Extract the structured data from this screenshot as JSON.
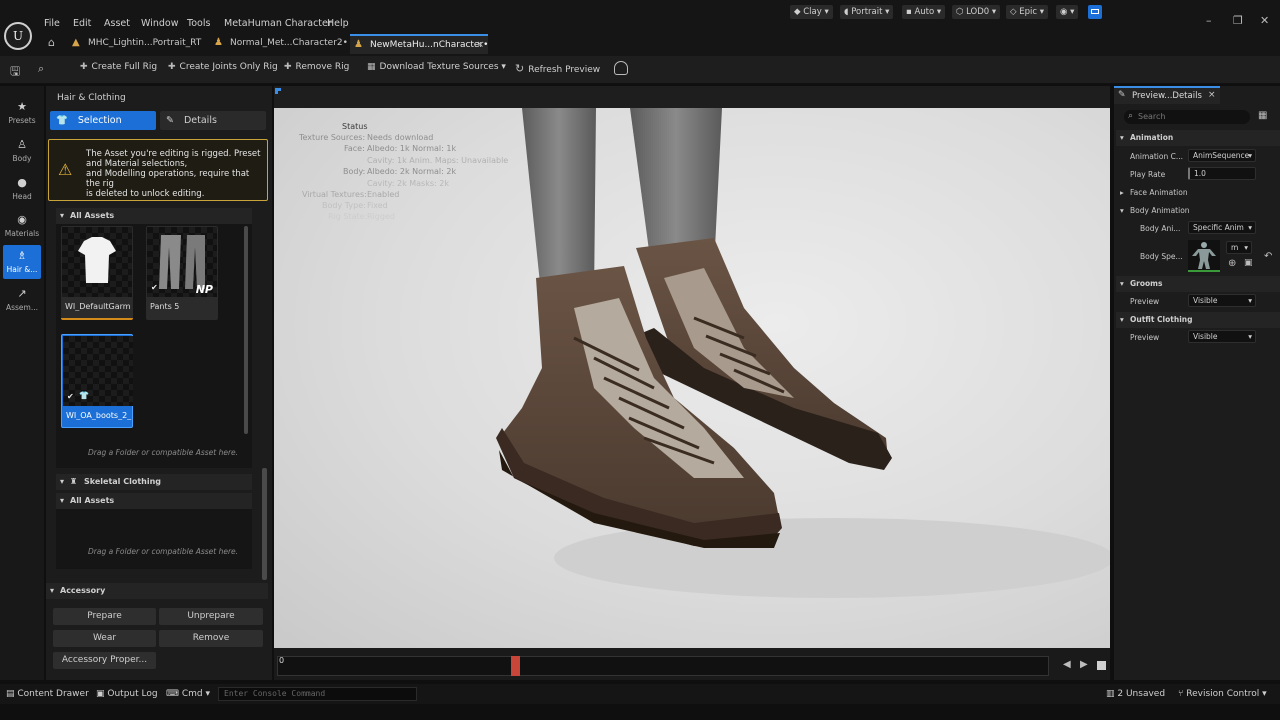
{
  "menu": [
    "File",
    "Edit",
    "Asset",
    "Window",
    "Tools",
    "MetaHuman Character",
    "Help"
  ],
  "tabs": [
    {
      "label": "MHC_Lightin...Portrait_RT",
      "active": false
    },
    {
      "label": "Normal_Met...Character2•",
      "active": false
    },
    {
      "label": "NewMetaHu...nCharacter•",
      "active": true
    }
  ],
  "toolbar": {
    "create_full_rig": "Create Full Rig",
    "create_joints_only_rig": "Create Joints Only Rig",
    "remove_rig": "Remove Rig",
    "download_texture_sources": "Download Texture Sources",
    "refresh_preview": "Refresh Preview"
  },
  "rail": [
    "Presets",
    "Body",
    "Head",
    "Materials",
    "Hair &...",
    "Assem..."
  ],
  "left_panel": {
    "title": "Hair & Clothing",
    "selection": "Selection",
    "details": "Details",
    "warning": "The Asset you're editing is rigged. Preset\nand Material selections,\nand Modelling operations, require that the rig\nis deleted to unlock editing.",
    "all_assets": "All Assets",
    "assets": [
      {
        "label": "WI_DefaultGarment"
      },
      {
        "label": "Pants 5",
        "badge": "NP"
      },
      {
        "label": "WI_OA_boots_2_..."
      }
    ],
    "drop_hint": "Drag a Folder or compatible Asset here.",
    "skeletal_clothing": "Skeletal Clothing",
    "all_assets_2": "All Assets",
    "drop_hint_2": "Drag a Folder or compatible Asset here.",
    "accessory": "Accessory",
    "buttons": {
      "prepare": "Prepare",
      "unprepare": "Unprepare",
      "wear": "Wear",
      "remove": "Remove",
      "accessory_properties": "Accessory Proper..."
    }
  },
  "viewport": {
    "clay": "Clay",
    "portrait": "Portrait",
    "auto": "Auto",
    "lod": "LOD0",
    "epic": "Epic",
    "status_title": "Status",
    "status_lines": [
      {
        "k": "Texture Sources:",
        "v": "Needs download"
      },
      {
        "k": "Face:",
        "v": "Albedo: 1k Normal: 1k"
      },
      {
        "k": "",
        "v": "Cavity: 1k  Anim. Maps: Unavailable"
      },
      {
        "k": "Body:",
        "v": "Albedo: 2k Normal: 2k"
      },
      {
        "k": "",
        "v": "Cavity: 2k  Masks: 2k"
      },
      {
        "k": "Virtual Textures:",
        "v": "Enabled"
      },
      {
        "k": "Body Type:",
        "v": "Fixed"
      },
      {
        "k": "Rig State:",
        "v": "Rigged"
      }
    ]
  },
  "timeline": {
    "frame": "0"
  },
  "right_panel": {
    "title": "Preview...Details",
    "search_placeholder": "Search",
    "animation": "Animation",
    "animation_class_label": "Animation C...",
    "animation_class_value": "AnimSequence",
    "play_rate_label": "Play Rate",
    "play_rate_value": "1.0",
    "face_animation": "Face Animation",
    "body_animation": "Body Animation",
    "body_ani_label": "Body Ani...",
    "body_ani_value": "Specific Anim",
    "body_spe_label": "Body Spe...",
    "body_spe_value": "m",
    "grooms": "Grooms",
    "grooms_preview_label": "Preview",
    "grooms_preview_value": "Visible",
    "outfit": "Outfit Clothing",
    "outfit_preview_label": "Preview",
    "outfit_preview_value": "Visible"
  },
  "statusbar": {
    "content_drawer": "Content Drawer",
    "output_log": "Output Log",
    "cmd": "Cmd",
    "console_placeholder": "Enter Console Command",
    "unsaved": "2 Unsaved",
    "revision_control": "Revision Control"
  }
}
